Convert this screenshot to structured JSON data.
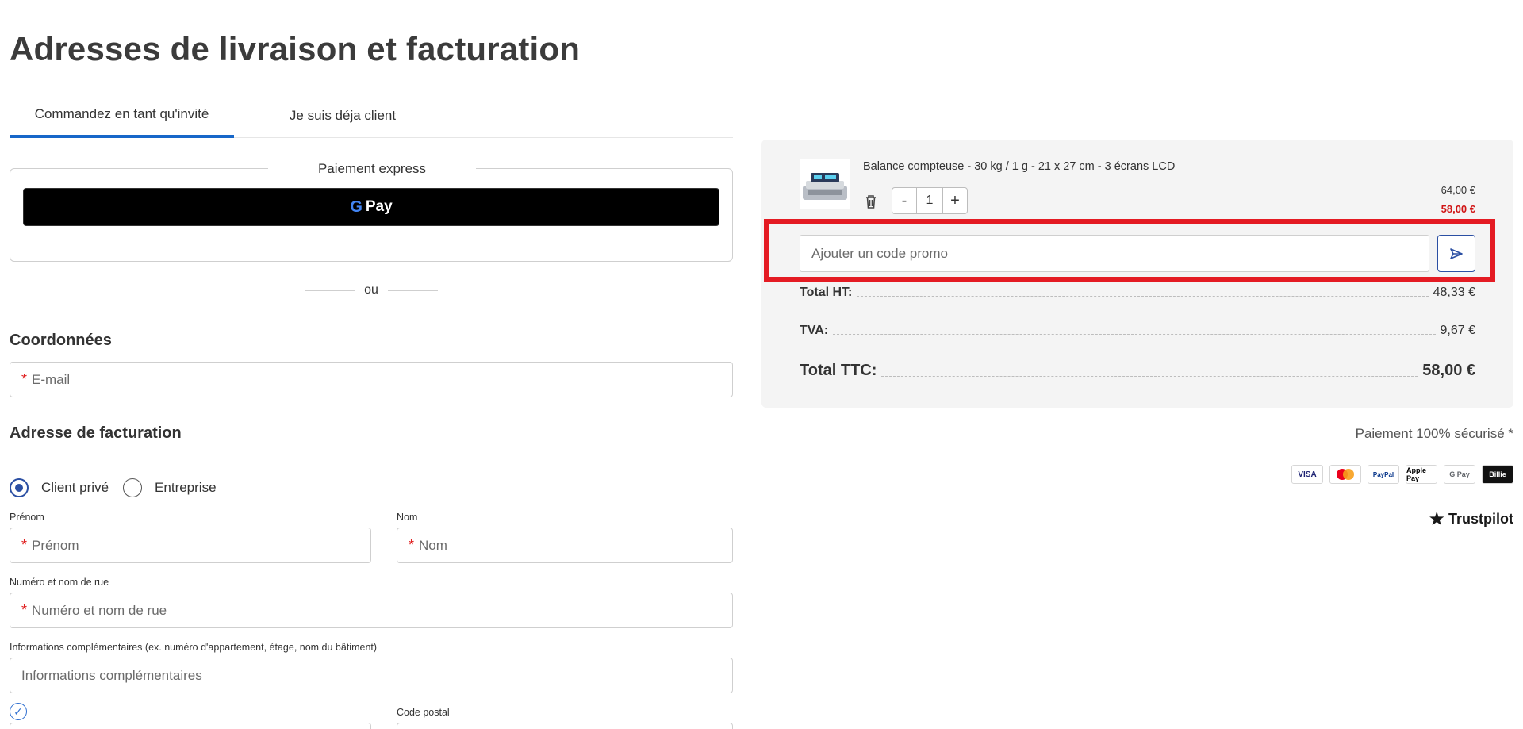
{
  "page": {
    "title": "Adresses de livraison et facturation"
  },
  "tabs": [
    {
      "label": "Commandez en tant qu'invité",
      "active": true
    },
    {
      "label": "Je suis déja client",
      "active": false
    }
  ],
  "express": {
    "legend": "Paiement express",
    "gpay_g": "G",
    "gpay_label": "Pay",
    "or_text": "ou"
  },
  "contact": {
    "title": "Coordonnées",
    "email_placeholder": "E-mail",
    "required_mark": "*"
  },
  "billing": {
    "title": "Adresse de facturation",
    "radio_private": "Client privé",
    "radio_company": "Entreprise",
    "firstname_label": "Prénom",
    "firstname_placeholder": "Prénom",
    "lastname_label": "Nom",
    "lastname_placeholder": "Nom",
    "street_label": "Numéro et nom de rue",
    "street_placeholder": "Numéro et nom de rue",
    "extra_label": "Informations complémentaires (ex. numéro d'appartement, étage, nom du bâtiment)",
    "extra_placeholder": "Informations complémentaires",
    "postal_label": "Code postal"
  },
  "cart": {
    "product_name": "Balance compteuse - 30 kg / 1 g - 21 x 27 cm - 3 écrans LCD",
    "qty_minus": "-",
    "qty_value": "1",
    "qty_plus": "+",
    "old_price": "64,00 €",
    "new_price": "58,00 €",
    "promo_placeholder": "Ajouter un code promo",
    "rows": [
      {
        "label": "Total HT:",
        "value": "48,33 €"
      },
      {
        "label": "TVA:",
        "value": "9,67 €"
      },
      {
        "label": "Total TTC:",
        "value": "58,00 €"
      }
    ]
  },
  "trust": {
    "secure_text": "Paiement 100% sécurisé *",
    "payment_methods": [
      "VISA",
      "Mastercard",
      "PayPal",
      "Apple Pay",
      "G Pay",
      "Billie"
    ],
    "trustpilot": "Trustpilot"
  },
  "colors": {
    "accent": "#1767c9",
    "brand_blue": "#2b4fa3",
    "price_red": "#d01414",
    "highlight_red": "#e41b23"
  }
}
